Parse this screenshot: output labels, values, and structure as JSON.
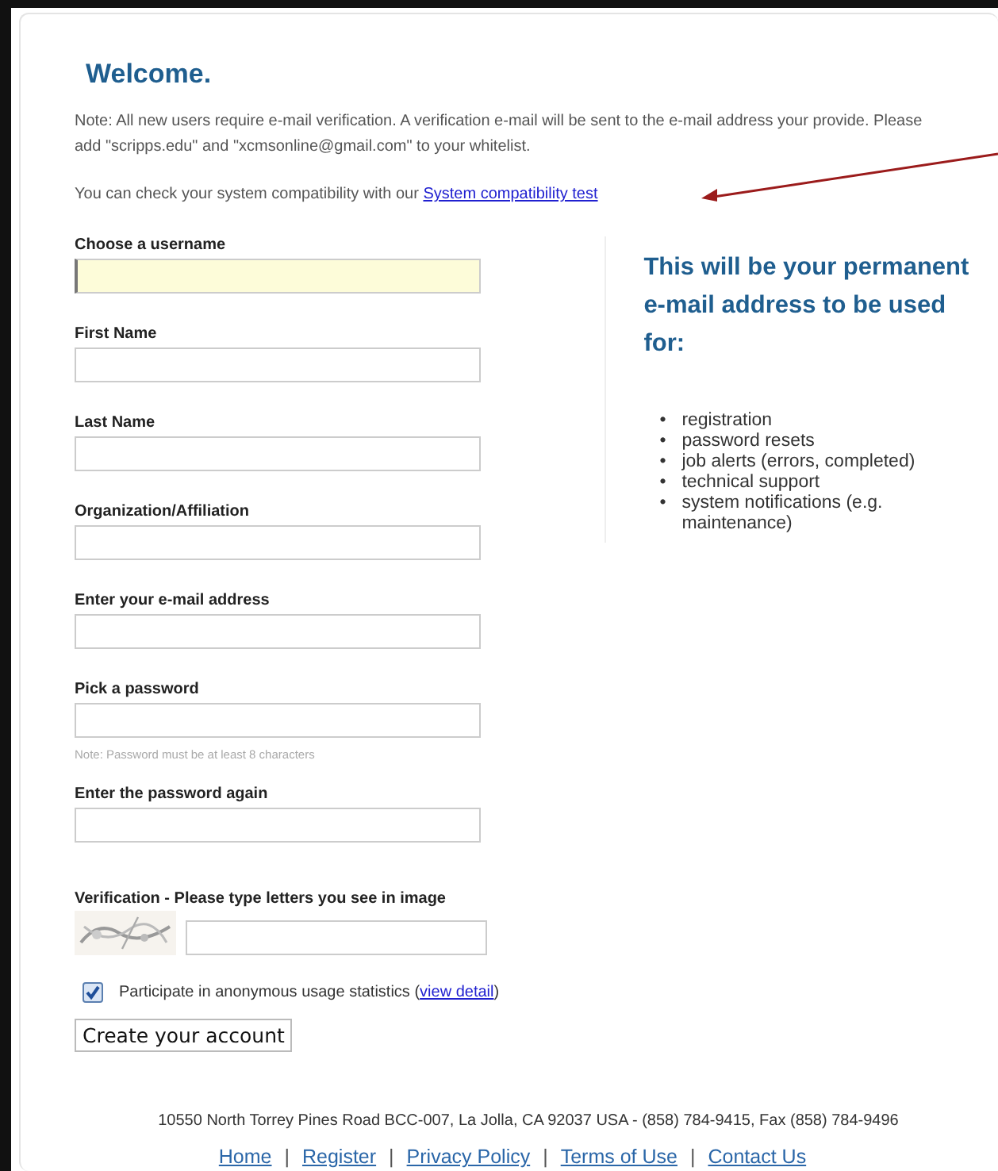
{
  "title": "Welcome.",
  "note": "Note: All new users require e-mail verification. A verification e-mail will be sent to the e-mail address your provide. Please add \"scripps.edu\" and \"xcmsonline@gmail.com\" to your whitelist.",
  "compatibility": {
    "text": "You can check your system compatibility with our",
    "link": "System compatibility test"
  },
  "fields": [
    {
      "label": "Choose a username",
      "focused": true
    },
    {
      "label": "First Name",
      "focused": false
    },
    {
      "label": "Last Name",
      "focused": false
    },
    {
      "label": "Organization/Affiliation",
      "focused": false
    },
    {
      "label": "Enter your e-mail address",
      "focused": false
    },
    {
      "label": "Pick a password",
      "focused": false,
      "note": "Note: Password must be at least 8 characters"
    },
    {
      "label": "Enter the password again",
      "focused": false
    }
  ],
  "info": {
    "bullet": "•",
    "heading": "This will be your permanent e-mail address to be used for:",
    "items": [
      "registration",
      "password resets",
      "job alerts (errors, completed)",
      "technical support",
      "system notifications (e.g. maintenance)"
    ]
  },
  "verification": {
    "label": "Verification - Please type letters you see in image"
  },
  "statistics": {
    "checked": true,
    "text": "Participate in anonymous usage statistics (",
    "link": "view detail",
    "after": ")"
  },
  "submit": "Create your account",
  "footer": {
    "separator": "|",
    "address": "10550 North Torrey Pines Road BCC-007, La Jolla, CA 92037 USA - (858) 784-9415, Fax (858) 784-9496",
    "links": [
      "Home",
      "Register",
      "Privacy Policy",
      "Terms of Use",
      "Contact Us"
    ]
  }
}
